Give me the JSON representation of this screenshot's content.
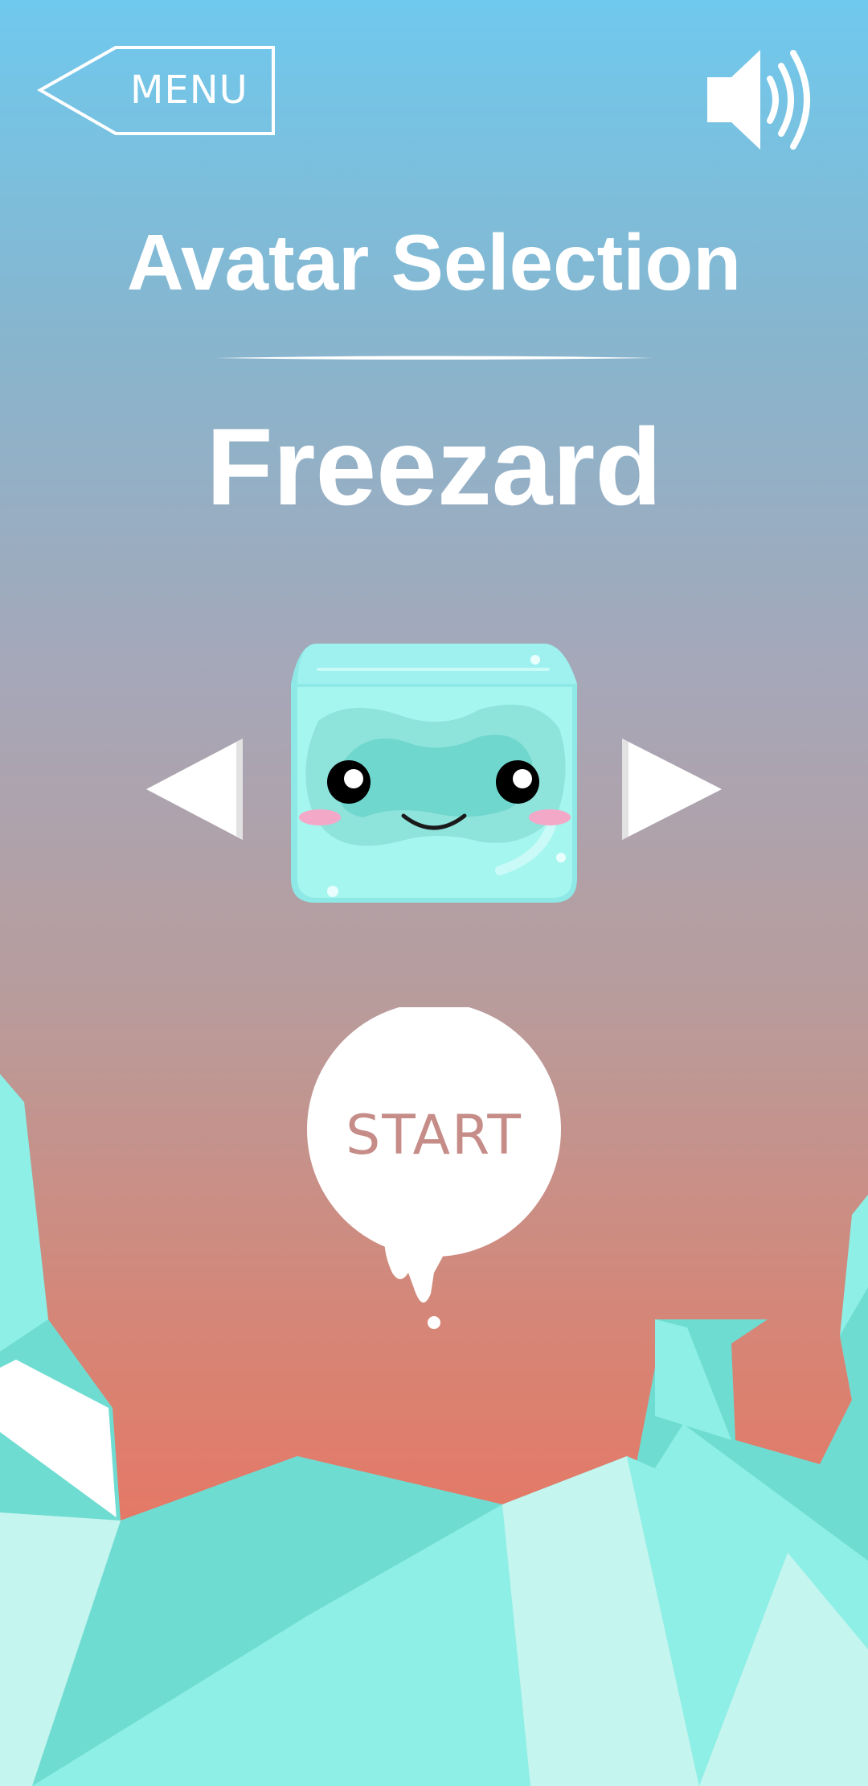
{
  "header": {
    "menu_label": "MENU",
    "menu_icon": "back-arrow-icon",
    "sound_icon": "speaker-volume-icon"
  },
  "screen": {
    "title": "Avatar Selection"
  },
  "avatar": {
    "name": "Freezard",
    "icon": "ice-cube-avatar",
    "prev_icon": "triangle-left-icon",
    "next_icon": "triangle-right-icon"
  },
  "actions": {
    "start_label": "START"
  },
  "colors": {
    "sky_top": "#6fc9ee",
    "sky_bottom": "#ea7460",
    "ice_dark": "#6fdcd2",
    "ice_light": "#c4f5ef",
    "start_text": "#c58c88"
  }
}
